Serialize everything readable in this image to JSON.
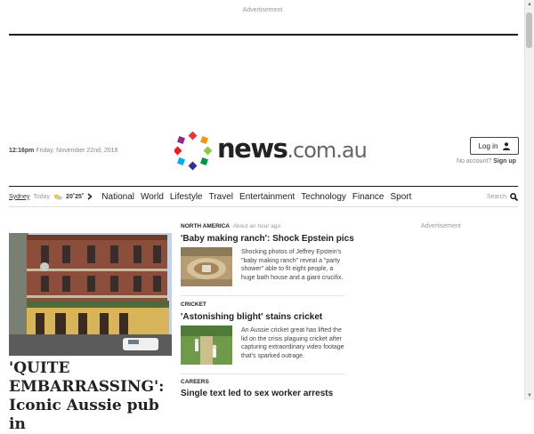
{
  "ads": {
    "top_label": "Advertisement",
    "side_label": "Advertisement"
  },
  "header": {
    "time": "12:16pm",
    "date": "Friday, November 22nd, 2019",
    "logo_main": "news",
    "logo_domain": ".com.au",
    "login_label": "Log in",
    "no_account": "No account?",
    "sign_up": "Sign up"
  },
  "weather": {
    "city": "Sydney",
    "day": "Today",
    "temps": "20˚25˚"
  },
  "nav": {
    "items": [
      "National",
      "World",
      "Lifestyle",
      "Travel",
      "Entertainment",
      "Technology",
      "Finance",
      "Sport"
    ],
    "search_label": "Search"
  },
  "hero": {
    "headline": "'QUITE EMBARRASSING': Iconic Aussie pub in"
  },
  "stories": [
    {
      "kicker": "North America",
      "time_ago": "About an hour ago",
      "headline": "'Baby making ranch': Shock Epstein pics",
      "teaser": "Shocking photos of Jeffrey Epstein's \"baby making ranch\" reveal a \"party shower\" able to fit eight people, a huge bath house and a giant crucifix."
    },
    {
      "kicker": "Cricket",
      "headline": "'Astonishing blight' stains cricket",
      "teaser": "An Aussie cricket great has lifted the lid on the crisis plaguing cricket after capturing extraordinary video footage that's sparked outrage."
    },
    {
      "kicker": "Careers",
      "headline": "Single text led to sex worker arrests"
    }
  ],
  "colors": {
    "logo_dots": [
      "#e03a3e",
      "#f7941d",
      "#8dc63f",
      "#00a79d",
      "#2e3192",
      "#92278f",
      "#ed1c24",
      "#00aeef"
    ]
  }
}
